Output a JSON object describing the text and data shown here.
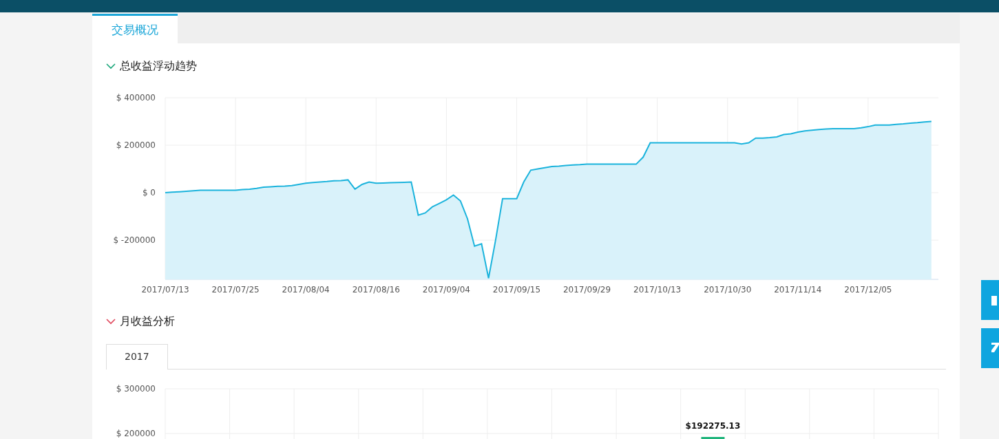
{
  "tabs": [
    {
      "label": "交易概况",
      "selected": true
    }
  ],
  "sections": [
    {
      "title": "总收益浮动趋势",
      "color": "#1aa67a",
      "chart_data": {
        "type": "area",
        "grid": true,
        "ylim": [
          -365000,
          400000
        ],
        "categories": [
          "2017/07/13",
          null,
          null,
          null,
          null,
          null,
          null,
          null,
          null,
          null,
          "2017/07/25",
          null,
          null,
          null,
          null,
          null,
          null,
          null,
          null,
          null,
          "2017/08/04",
          null,
          null,
          null,
          null,
          null,
          null,
          null,
          null,
          null,
          "2017/08/16",
          null,
          null,
          null,
          null,
          null,
          null,
          null,
          null,
          null,
          "2017/09/04",
          null,
          null,
          null,
          null,
          null,
          null,
          null,
          null,
          null,
          "2017/09/15",
          null,
          null,
          null,
          null,
          null,
          null,
          null,
          null,
          null,
          "2017/09/29",
          null,
          null,
          null,
          null,
          null,
          null,
          null,
          null,
          null,
          "2017/10/13",
          null,
          null,
          null,
          null,
          null,
          null,
          null,
          null,
          null,
          "2017/10/30",
          null,
          null,
          null,
          null,
          null,
          null,
          null,
          null,
          null,
          "2017/11/14",
          null,
          null,
          null,
          null,
          null,
          null,
          null,
          null,
          null,
          "2017/12/05",
          null,
          null,
          null,
          null,
          null,
          null,
          null,
          null,
          null
        ],
        "yticks": [
          {
            "value": -200000,
            "label": "$ -200000"
          },
          {
            "value": 0,
            "label": "$ 0"
          },
          {
            "value": 200000,
            "label": "$ 200000"
          },
          {
            "value": 400000,
            "label": "$ 400000"
          }
        ],
        "series": [
          {
            "color": "#1ab3dc",
            "values": [
              0,
              2000,
              4000,
              6000,
              8000,
              10000,
              10000,
              10000,
              10000,
              10000,
              10000,
              13000,
              15000,
              18000,
              23000,
              25000,
              27000,
              28000,
              30000,
              35000,
              40000,
              43000,
              45000,
              47000,
              50000,
              51000,
              54000,
              15000,
              35000,
              45000,
              40000,
              41000,
              42000,
              43000,
              44000,
              45000,
              -95000,
              -85000,
              -60000,
              -45000,
              -30000,
              -10000,
              -35000,
              -110000,
              -225000,
              -215000,
              -360000,
              -200000,
              -25000,
              -25000,
              -25000,
              45000,
              95000,
              100000,
              105000,
              110000,
              112000,
              115000,
              117000,
              118000,
              120000,
              120000,
              120000,
              120000,
              120000,
              120000,
              120000,
              120000,
              150000,
              210000,
              210000,
              210000,
              210000,
              210000,
              210000,
              210000,
              210000,
              210000,
              210000,
              210000,
              210000,
              210000,
              205000,
              210000,
              230000,
              230000,
              232000,
              235000,
              245000,
              248000,
              255000,
              260000,
              263000,
              266000,
              268000,
              270000,
              270000,
              270000,
              270000,
              273000,
              278000,
              285000,
              285000,
              285000,
              288000,
              290000,
              293000,
              295000,
              298000,
              300000
            ]
          }
        ]
      }
    },
    {
      "title": "月收益分析",
      "color": "#e0455a",
      "year_tabs": [
        {
          "label": "2017",
          "selected": true
        }
      ],
      "chart_data": {
        "type": "bar",
        "grid": true,
        "ylim": [
          186000,
          300000
        ],
        "yticks": [
          {
            "value": 200000,
            "label": "$ 200000"
          },
          {
            "value": 300000,
            "label": "$ 300000"
          }
        ],
        "series": [
          {
            "color": "#1db37a",
            "values": [
              null,
              null,
              null,
              null,
              null,
              null,
              null,
              null,
              192275.13,
              null,
              null,
              null
            ]
          }
        ],
        "value_labels": [
          null,
          null,
          null,
          null,
          null,
          null,
          null,
          null,
          "$192275.13",
          null,
          null,
          null
        ]
      }
    }
  ]
}
